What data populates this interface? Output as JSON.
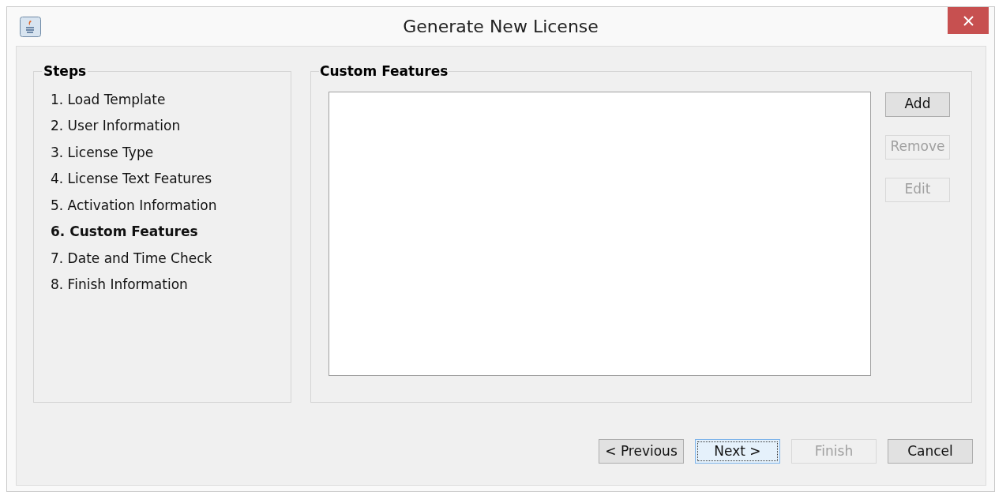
{
  "window": {
    "title": "Generate New License"
  },
  "steps": {
    "title": "Steps",
    "items": [
      {
        "label": "1. Load Template",
        "selected": false
      },
      {
        "label": "2. User Information",
        "selected": false
      },
      {
        "label": "3. License Type",
        "selected": false
      },
      {
        "label": "4. License Text Features",
        "selected": false
      },
      {
        "label": "5. Activation Information",
        "selected": false
      },
      {
        "label": "6. Custom Features",
        "selected": true
      },
      {
        "label": "7. Date and Time Check",
        "selected": false
      },
      {
        "label": "8. Finish Information",
        "selected": false
      }
    ]
  },
  "custom_features": {
    "title": "Custom Features",
    "buttons": [
      {
        "label": "Add",
        "disabled": false
      },
      {
        "label": "Remove",
        "disabled": true
      },
      {
        "label": "Edit",
        "disabled": true
      }
    ]
  },
  "footer_buttons": [
    {
      "label": "< Previous",
      "disabled": false,
      "focused": false
    },
    {
      "label": "Next >",
      "disabled": false,
      "focused": true
    },
    {
      "label": "Finish",
      "disabled": true,
      "focused": false
    },
    {
      "label": "Cancel",
      "disabled": false,
      "focused": false
    }
  ]
}
